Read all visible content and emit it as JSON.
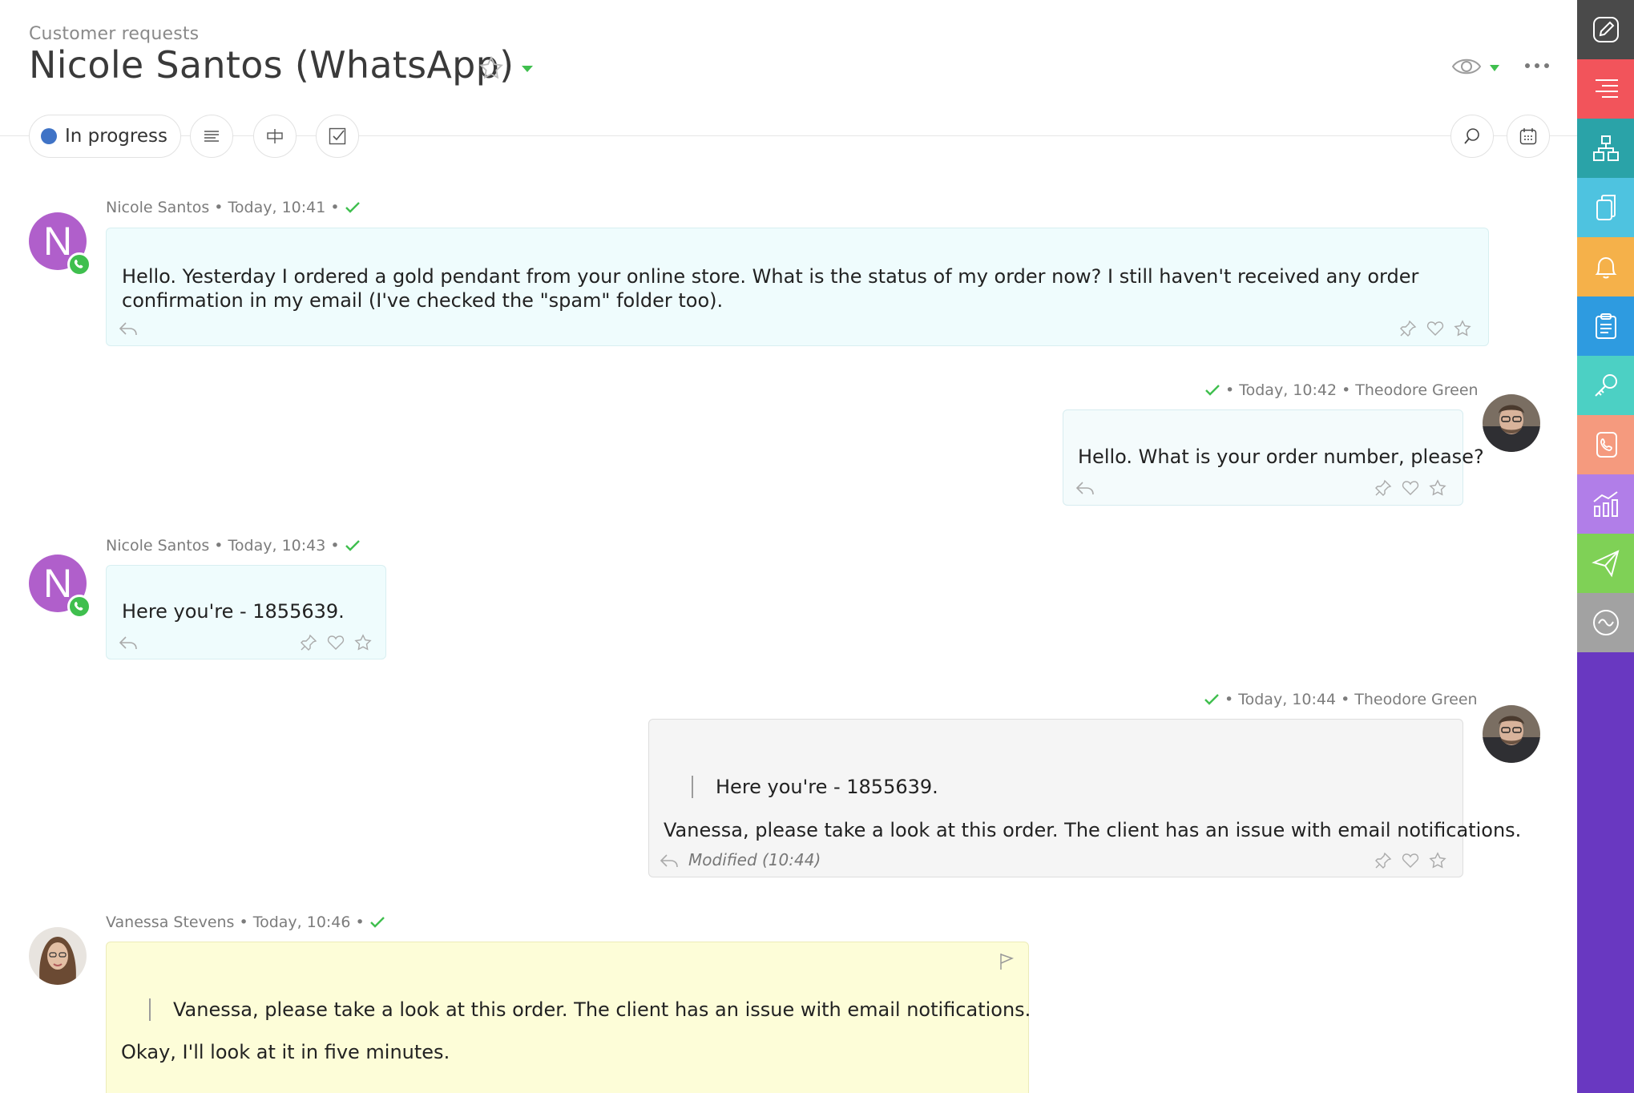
{
  "header": {
    "breadcrumb": "Customer requests",
    "title": "Nicole Santos (WhatsApp)"
  },
  "toolbar": {
    "status_label": "In progress",
    "status_color": "#3f73c6"
  },
  "messages": [
    {
      "author": "Nicole Santos",
      "time": "• Today, 10:41 •",
      "avatar_letter": "N",
      "text": "Hello. Yesterday I ordered a gold pendant from your online store. What is the status of my order now? I still haven't received any order confirmation in my email (I've checked the \"spam\" folder too)."
    },
    {
      "author": "Theodore Green",
      "time": "• Today, 10:42 •",
      "text": "Hello. What is your order number, please?"
    },
    {
      "author": "Nicole Santos",
      "time": "• Today, 10:43 •",
      "avatar_letter": "N",
      "text": "Here you're - 1855639."
    },
    {
      "author": "Theodore Green",
      "time": "• Today, 10:44 •",
      "quote": "Here you're - 1855639.",
      "text": "Vanessa, please take a look at this order. The client has an issue with email notifications.",
      "modified": "Modified (10:44)"
    },
    {
      "author": "Vanessa Stevens",
      "time": "• Today, 10:46 •",
      "quote": "Vanessa, please take a look at this order. The client has an issue with email notifications.",
      "text": "Okay, I'll look at it in five minutes."
    }
  ],
  "rail": {
    "items": [
      {
        "icon": "edit-icon",
        "color": "#4a4a4a"
      },
      {
        "icon": "menu-lines-icon",
        "color": "#f2545b"
      },
      {
        "icon": "structure-icon",
        "color": "#2aa3a8"
      },
      {
        "icon": "documents-icon",
        "color": "#4ec3e0"
      },
      {
        "icon": "bell-icon",
        "color": "#f5b14a"
      },
      {
        "icon": "clipboard-icon",
        "color": "#2e9be0"
      },
      {
        "icon": "key-icon",
        "color": "#4cd0c4"
      },
      {
        "icon": "phone-book-icon",
        "color": "#f59a7e"
      },
      {
        "icon": "chart-icon",
        "color": "#b17ee8"
      },
      {
        "icon": "send-icon",
        "color": "#7fd156"
      },
      {
        "icon": "wave-icon",
        "color": "#a2a2a2"
      }
    ],
    "background": "#6938c1"
  }
}
